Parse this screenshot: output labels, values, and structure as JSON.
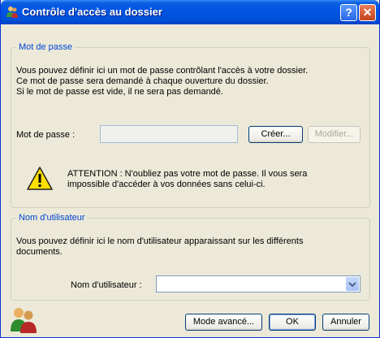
{
  "window": {
    "title": "Contrôle d'accès au dossier",
    "help_label": "?",
    "close_label": "✕"
  },
  "password_section": {
    "legend": "Mot de passe",
    "description_lines": [
      "Vous pouvez définir ici un mot de passe contrôlant l'accès à votre dossier.",
      "Ce mot de passe sera demandé à chaque ouverture du dossier.",
      "Si le mot de passe est vide, il ne sera pas demandé."
    ],
    "field_label": "Mot de passe :",
    "field_value": "",
    "create_button": "Créer...",
    "modify_button": "Modifier...",
    "warning_lines": [
      "ATTENTION : N'oubliez pas votre mot de passe. Il vous sera",
      "impossible d'accéder à vos données sans celui-ci."
    ],
    "warning_icon": "warning-triangle-icon"
  },
  "username_section": {
    "legend": "Nom d'utilisateur",
    "description_lines": [
      "Vous pouvez définir ici le nom d'utilisateur apparaissant sur les différents",
      "documents."
    ],
    "field_label": "Nom d'utilisateur :",
    "field_value": ""
  },
  "footer": {
    "icon": "users-icon",
    "advanced_button": "Mode avancé...",
    "ok_button": "OK",
    "cancel_button": "Annuler"
  },
  "colors": {
    "titlebar": "#0055E5",
    "legend": "#0046D5",
    "dialog_bg": "#ECE9D8"
  }
}
